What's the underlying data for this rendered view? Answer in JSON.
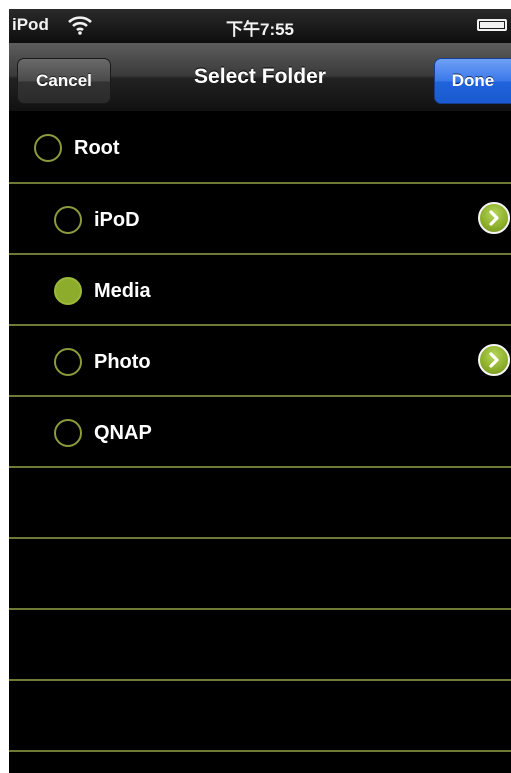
{
  "status_bar": {
    "carrier": "iPod",
    "time": "下午7:55",
    "wifi_icon": "wifi-icon",
    "battery_icon": "battery-icon"
  },
  "nav_bar": {
    "title": "Select Folder",
    "cancel_label": "Cancel",
    "done_label": "Done"
  },
  "colors": {
    "accent": "#8eac2c",
    "separator": "#6f7a36",
    "done_button": "#2f6fe4",
    "background": "#000000"
  },
  "folders": [
    {
      "label": "Root",
      "selected": false,
      "has_children": false,
      "indent": 0
    },
    {
      "label": "iPoD",
      "selected": false,
      "has_children": true,
      "indent": 1
    },
    {
      "label": "Media",
      "selected": true,
      "has_children": false,
      "indent": 1
    },
    {
      "label": "Photo",
      "selected": false,
      "has_children": true,
      "indent": 1
    },
    {
      "label": "QNAP",
      "selected": false,
      "has_children": false,
      "indent": 1
    }
  ]
}
